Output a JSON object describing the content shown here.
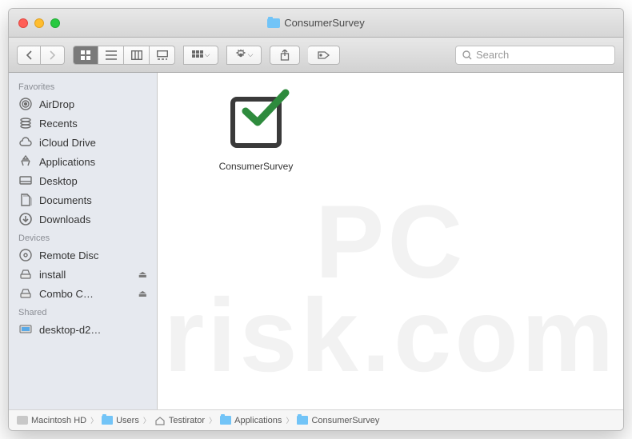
{
  "window": {
    "title": "ConsumerSurvey"
  },
  "search": {
    "placeholder": "Search"
  },
  "sidebar": {
    "sections": [
      {
        "header": "Favorites",
        "items": [
          {
            "icon": "airdrop",
            "label": "AirDrop"
          },
          {
            "icon": "recents",
            "label": "Recents"
          },
          {
            "icon": "icloud",
            "label": "iCloud Drive"
          },
          {
            "icon": "apps",
            "label": "Applications"
          },
          {
            "icon": "desktop",
            "label": "Desktop"
          },
          {
            "icon": "docs",
            "label": "Documents"
          },
          {
            "icon": "downloads",
            "label": "Downloads"
          }
        ]
      },
      {
        "header": "Devices",
        "items": [
          {
            "icon": "disc",
            "label": "Remote Disc"
          },
          {
            "icon": "drive",
            "label": "install",
            "eject": true
          },
          {
            "icon": "drive",
            "label": "Combo C…",
            "eject": true
          }
        ]
      },
      {
        "header": "Shared",
        "items": [
          {
            "icon": "pc",
            "label": "desktop-d2…"
          }
        ]
      }
    ]
  },
  "content": {
    "items": [
      {
        "label": "ConsumerSurvey"
      }
    ]
  },
  "path": [
    {
      "icon": "hd",
      "label": "Macintosh HD"
    },
    {
      "icon": "fd",
      "label": "Users"
    },
    {
      "icon": "home",
      "label": "Testirator"
    },
    {
      "icon": "fd",
      "label": "Applications"
    },
    {
      "icon": "fd",
      "label": "ConsumerSurvey"
    }
  ]
}
